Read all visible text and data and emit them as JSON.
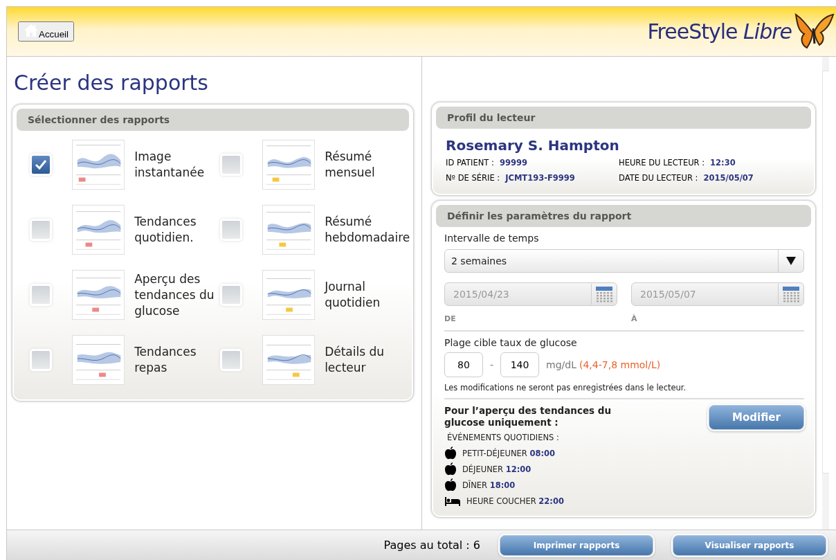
{
  "header": {
    "home_button": "Accueil",
    "logo": "FreeStyle *Libre*"
  },
  "page_title": "Créer des rapports",
  "reports_panel": {
    "title": "Sélectionner des rapports",
    "reports": [
      {
        "label": "Image instantanée",
        "checked": true
      },
      {
        "label": "Résumé mensuel",
        "checked": false
      },
      {
        "label": "Tendances quotidien.",
        "checked": false
      },
      {
        "label": "Résumé hebdomadaire",
        "checked": false
      },
      {
        "label": "Aperçu des tendances du glucose",
        "checked": false
      },
      {
        "label": "Journal quotidien",
        "checked": false
      },
      {
        "label": "Tendances repas",
        "checked": false
      },
      {
        "label": "Détails du lecteur",
        "checked": false
      }
    ]
  },
  "profile": {
    "title": "Profil du lecteur",
    "name": "Rosemary S. Hampton",
    "fields": [
      {
        "label": "ID PATIENT :",
        "value": "99999"
      },
      {
        "label": "HEURE DU LECTEUR :",
        "value": "12:30"
      },
      {
        "label": "Nº DE SÉRIE :",
        "value": "JCMT193-F9999"
      },
      {
        "label": "DATE DU LECTEUR :",
        "value": "2015/05/07"
      }
    ]
  },
  "parameters": {
    "title": "Définir les paramètres du rapport",
    "time_range_label": "Intervalle de temps",
    "time_range": "2 semaines",
    "dates": [
      {
        "value": "2015/04/23",
        "label": "DE",
        "disabled": true
      },
      {
        "value": "2015/05/07",
        "label": "À",
        "disabled": true
      }
    ],
    "target_label": "Plage cible taux de glucose",
    "target_low": "80",
    "separator": "-",
    "target_high": "140",
    "unit": "mg/dL",
    "unit_alt": "(4,4-7,8 mmol/L)",
    "note": "Les modifications ne seront pas enregistrées dans le lecteur.",
    "glucose_title": "Pour l’aperçu des tendances du glucose uniquement :",
    "modify_button": "Modifier",
    "events_label": "ÉVÉNEMENTS QUOTIDIENS :",
    "events": [
      {
        "kind": "meal",
        "name": "PETIT-DÉJEUNER",
        "time": "08:00"
      },
      {
        "kind": "meal",
        "name": "DÉJEUNER",
        "time": "12:00"
      },
      {
        "kind": "meal",
        "name": "DÎNER",
        "time": "18:00"
      },
      {
        "kind": "bedtime",
        "name": "HEURE COUCHER",
        "time": "22:00"
      }
    ]
  },
  "footer": {
    "pages": "Pages au total : 6",
    "buttons": [
      "Imprimer rapports",
      "Visualiser rapports"
    ]
  }
}
